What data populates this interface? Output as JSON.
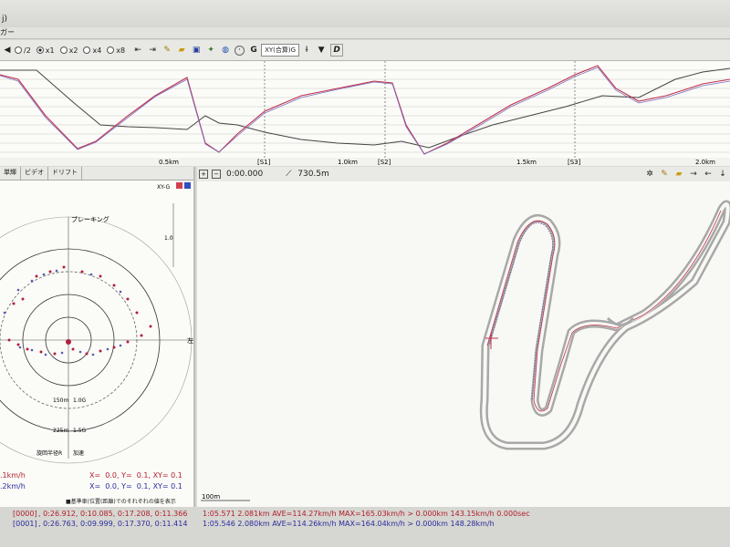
{
  "window": {
    "title": "j)",
    "menu": "ガー"
  },
  "toolbar": {
    "zoom_options": [
      {
        "label": "/2",
        "selected": false
      },
      {
        "label": "x1",
        "selected": true
      },
      {
        "label": "x2",
        "selected": false
      },
      {
        "label": "x4",
        "selected": false
      },
      {
        "label": "x8",
        "selected": false
      }
    ],
    "mode_select": "XY(合算)G",
    "d_label": "D"
  },
  "speed_graph": {
    "distance_labels": [
      "0.5km",
      "1.0km",
      "1.5km",
      "2.0km"
    ],
    "sector_labels": [
      "[S1]",
      "[S2]",
      "[S3]"
    ],
    "colors": {
      "lap0": "#c0304a",
      "lap1": "#3a3a9a",
      "lap1_alt": "#444444"
    }
  },
  "left_panel": {
    "tabs": [
      "単輝",
      "ビデオ",
      "ドリフト"
    ],
    "gg_label": "XY-G",
    "braking_label": "ブレーキング",
    "left_label": "左",
    "scale_value": "1.0",
    "ring_labels": [
      {
        "radius": "150m",
        "g": "1.0G"
      },
      {
        "radius": "225m",
        "g": "1.5G"
      }
    ],
    "bottom_labels": {
      "turn_radius": "旋回半径R",
      "accel": "加速"
    },
    "readouts": [
      {
        "speed": ".1km/h",
        "xy": "X=  0.0, Y=  0.1, XY= 0.1",
        "color": "lap0"
      },
      {
        "speed": ".2km/h",
        "xy": "X=  0.0, Y=  0.1, XY= 0.1",
        "color": "lap1"
      }
    ],
    "footer": "■基準車(位置(距離)でのそれぞれの値を表示"
  },
  "map_panel": {
    "time": "0:00.000",
    "distance": "730.5m",
    "scale_label": "100m"
  },
  "status": {
    "lines": [
      {
        "id": "[0000]",
        "splits": ", 0:26.912, 0:10.085, 0:17.208, 0:11.366",
        "summary": "1:05.571 2.081km AVE=114.27km/h MAX=165.03km/h > 0.000km 143.15km/h 0.000sec",
        "color": "lap0"
      },
      {
        "id": "[0001]",
        "splits": ", 0:26.763, 0:09.999, 0:17.370, 0:11.414",
        "summary": "1:05.546 2.080km AVE=114.26km/h MAX=164.04km/h > 0.000km 148.28km/h",
        "color": "lap1"
      }
    ]
  }
}
